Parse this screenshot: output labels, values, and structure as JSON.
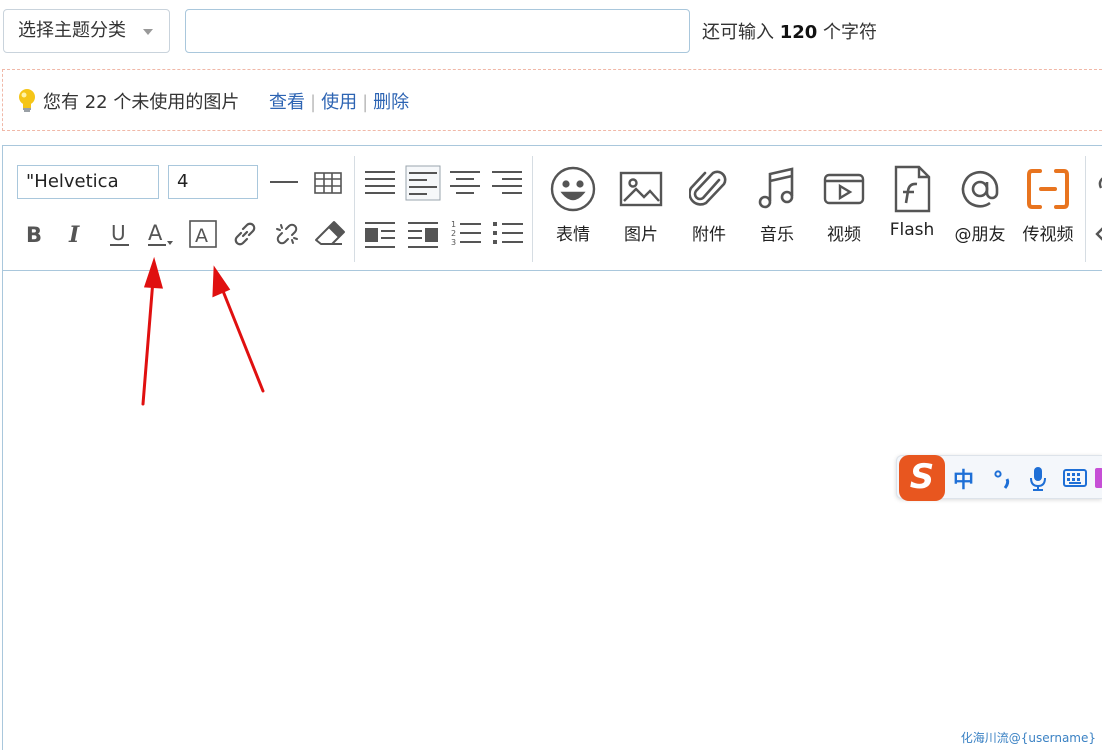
{
  "header": {
    "category_label": "选择主题分类",
    "title_placeholder": "",
    "char_count_prefix": "还可输入",
    "char_count_value": "120",
    "char_count_suffix": "个字符"
  },
  "notice": {
    "message": "您有 22 个未使用的图片",
    "view_link": "查看",
    "use_link": "使用",
    "delete_link": "删除"
  },
  "toolbar": {
    "font_family": "\"Helvetica",
    "font_size": "4",
    "buttons": [
      {
        "label": "表情",
        "icon": "smiley-icon"
      },
      {
        "label": "图片",
        "icon": "image-icon"
      },
      {
        "label": "附件",
        "icon": "paperclip-icon"
      },
      {
        "label": "音乐",
        "icon": "music-note-icon"
      },
      {
        "label": "视频",
        "icon": "video-icon"
      },
      {
        "label": "Flash",
        "icon": "flash-icon"
      },
      {
        "label": "@朋友",
        "icon": "at-icon"
      },
      {
        "label": "传视频",
        "icon": "upload-video-icon"
      }
    ],
    "accent_color": "#e8741f"
  },
  "ime": {
    "logo": "S",
    "mode": "中"
  },
  "watermark": "化海川流@{username}",
  "colors": {
    "link": "#2d64b3",
    "border": "#a9c7dc",
    "annotation_arrow": "#e01010"
  }
}
